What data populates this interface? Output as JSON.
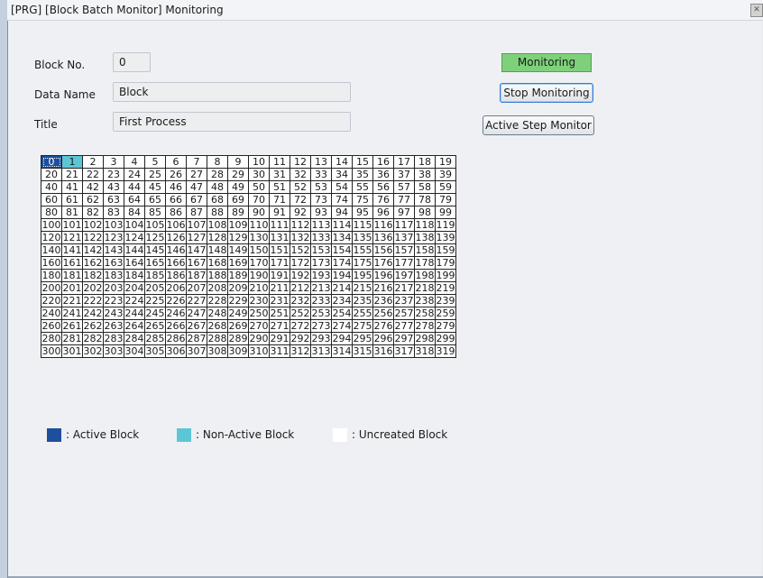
{
  "window": {
    "title": "[PRG] [Block Batch Monitor] Monitoring",
    "close_icon": "close-icon"
  },
  "fields": {
    "block_no": {
      "label": "Block No.",
      "value": "0"
    },
    "data_name": {
      "label": "Data Name",
      "value": "Block"
    },
    "title": {
      "label": "Title",
      "value": "First Process"
    }
  },
  "status": {
    "text": "Monitoring",
    "color": "#7ed17a"
  },
  "buttons": {
    "stop_monitoring": "Stop Monitoring",
    "active_step_monitor": "Active Step Monitor"
  },
  "grid": {
    "first_block": 0,
    "last_block": 319,
    "columns": 20,
    "active_blocks": [
      0
    ],
    "non_active_blocks": [
      1
    ]
  },
  "legend": {
    "active": {
      "label": ": Active Block",
      "color": "#1d4f9c"
    },
    "non_active": {
      "label": ": Non-Active Block",
      "color": "#5cc6d6"
    },
    "uncreated": {
      "label": ": Uncreated Block",
      "color": "#ffffff"
    }
  }
}
